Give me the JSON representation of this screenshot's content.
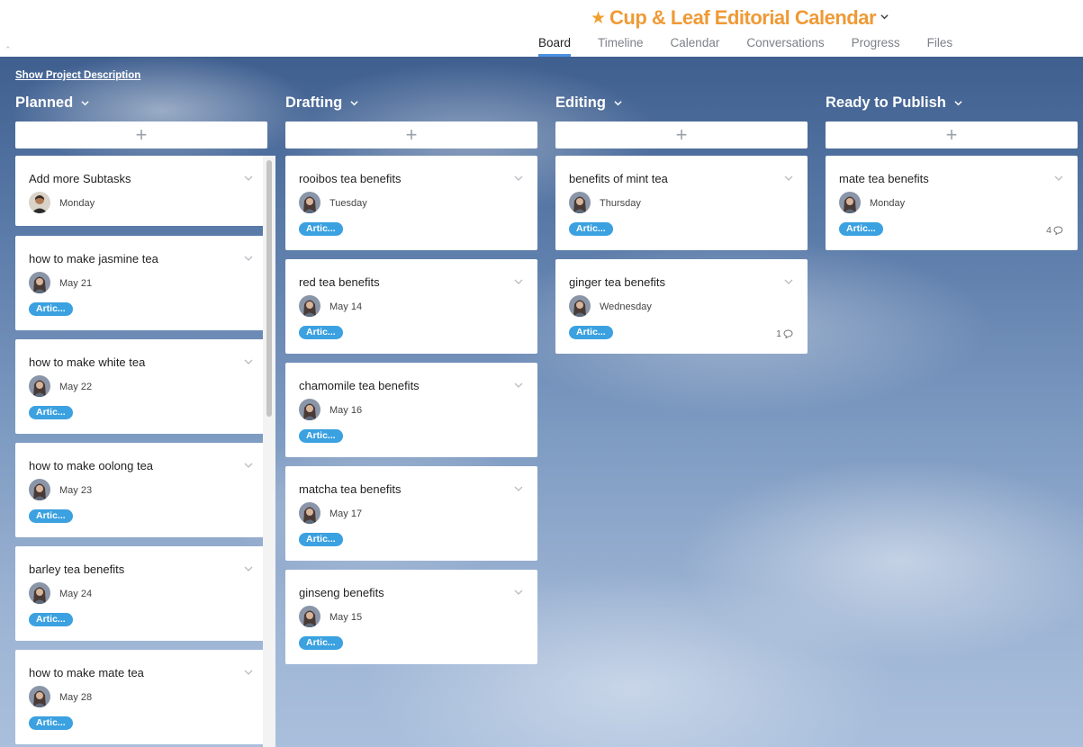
{
  "project": {
    "title": "Cup & Leaf Editorial Calendar",
    "accent_color": "#ef9a36",
    "star_color": "#f0a030"
  },
  "tabs": [
    {
      "label": "Board",
      "active": true
    },
    {
      "label": "Timeline",
      "active": false
    },
    {
      "label": "Calendar",
      "active": false
    },
    {
      "label": "Conversations",
      "active": false
    },
    {
      "label": "Progress",
      "active": false
    },
    {
      "label": "Files",
      "active": false
    }
  ],
  "board": {
    "show_description_label": "Show Project Description",
    "tag_color": "#3ba1e0",
    "columns": [
      {
        "name": "Planned",
        "cards": [
          {
            "name": "Add more Subtasks",
            "date": "Monday",
            "tag": "",
            "avatar": "man"
          },
          {
            "name": "how to make jasmine tea",
            "date": "May 21",
            "tag": "Artic...",
            "avatar": "woman"
          },
          {
            "name": "how to make white tea",
            "date": "May 22",
            "tag": "Artic...",
            "avatar": "woman"
          },
          {
            "name": "how to make oolong tea",
            "date": "May 23",
            "tag": "Artic...",
            "avatar": "woman"
          },
          {
            "name": "barley tea benefits",
            "date": "May 24",
            "tag": "Artic...",
            "avatar": "woman"
          },
          {
            "name": "how to make mate tea",
            "date": "May 28",
            "tag": "Artic...",
            "avatar": "woman"
          }
        ]
      },
      {
        "name": "Drafting",
        "cards": [
          {
            "name": "rooibos tea benefits",
            "date": "Tuesday",
            "tag": "Artic...",
            "avatar": "woman"
          },
          {
            "name": "red tea benefits",
            "date": "May 14",
            "tag": "Artic...",
            "avatar": "woman"
          },
          {
            "name": "chamomile tea benefits",
            "date": "May 16",
            "tag": "Artic...",
            "avatar": "woman"
          },
          {
            "name": "matcha tea benefits",
            "date": "May 17",
            "tag": "Artic...",
            "avatar": "woman"
          },
          {
            "name": "ginseng benefits",
            "date": "May 15",
            "tag": "Artic...",
            "avatar": "woman"
          }
        ]
      },
      {
        "name": "Editing",
        "cards": [
          {
            "name": "benefits of mint tea",
            "date": "Thursday",
            "tag": "Artic...",
            "avatar": "woman"
          },
          {
            "name": "ginger tea benefits",
            "date": "Wednesday",
            "tag": "Artic...",
            "avatar": "woman",
            "comments": "1"
          }
        ]
      },
      {
        "name": "Ready to Publish",
        "cards": [
          {
            "name": "mate tea benefits",
            "date": "Monday",
            "tag": "Artic...",
            "avatar": "woman",
            "comments": "4"
          }
        ]
      }
    ]
  },
  "icons": {
    "collapse": "chevron-up-icon",
    "star": "star-icon",
    "add": "plus-icon",
    "menu": "chevron-down-icon",
    "comment": "comment-bubble-icon"
  }
}
